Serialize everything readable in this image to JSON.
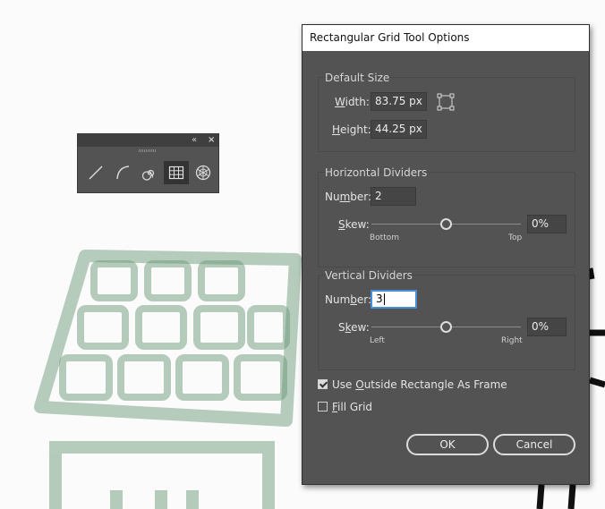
{
  "tools_panel": {
    "collapse_glyph": "«",
    "close_glyph": "×",
    "tools": [
      {
        "name": "line-segment-tool",
        "icon": "line-segment-icon"
      },
      {
        "name": "arc-tool",
        "icon": "arc-icon"
      },
      {
        "name": "spiral-tool",
        "icon": "spiral-icon"
      },
      {
        "name": "rectangular-grid-tool",
        "icon": "rectangular-grid-icon",
        "active": true
      },
      {
        "name": "polar-grid-tool",
        "icon": "polar-grid-icon"
      }
    ]
  },
  "dialog": {
    "title": "Rectangular Grid Tool Options",
    "default_size": {
      "label": "Default Size",
      "width_label_pre": "W",
      "width_label_rest": "idth:",
      "width_value": "83.75 px",
      "height_label_pre": "H",
      "height_label_rest": "eight:",
      "height_value": "44.25 px"
    },
    "horizontal_dividers": {
      "label": "Horizontal Dividers",
      "number_label_pre": "Nu",
      "number_label_u": "m",
      "number_label_rest": "ber:",
      "number_value": "2",
      "skew_label_pre": "",
      "skew_label_u": "S",
      "skew_label_rest": "kew:",
      "skew_value": "0%",
      "skew_level": 0.5,
      "left_label": "Bottom",
      "right_label": "Top"
    },
    "vertical_dividers": {
      "label": "Vertical Dividers",
      "number_label_pre": "Num",
      "number_label_u": "b",
      "number_label_rest": "er:",
      "number_value": "3",
      "skew_label_pre": "S",
      "skew_label_u": "k",
      "skew_label_rest": "ew:",
      "skew_value": "0%",
      "skew_level": 0.5,
      "left_label": "Left",
      "right_label": "Right"
    },
    "use_outside_rect": {
      "pre": "Use ",
      "u": "O",
      "rest": "utside Rectangle As Frame",
      "checked": true
    },
    "fill_grid": {
      "u": "F",
      "rest": "ill Grid",
      "checked": false
    },
    "ok_label": "OK",
    "cancel_label": "Cancel"
  },
  "colors": {
    "dialog_bg": "#535353",
    "field_bg": "#454545",
    "focus_border": "#4a8ed8",
    "artwork_green": "#6f9b7b"
  }
}
